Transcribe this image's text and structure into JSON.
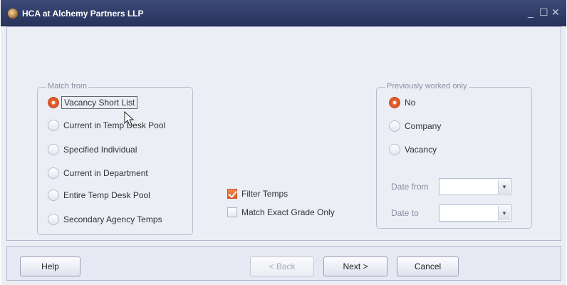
{
  "window": {
    "title": "HCA at Alchemy Partners LLP",
    "controls": {
      "minimize": "_",
      "maximize": "☐",
      "close": "✕"
    }
  },
  "match_from": {
    "legend": "Match from",
    "selected": "Vacancy Short List",
    "options": [
      {
        "label": "Vacancy Short List",
        "checked": true
      },
      {
        "label": "Current in Temp Desk Pool",
        "checked": false
      },
      {
        "label": "Specified Individual",
        "checked": false
      },
      {
        "label": "Current in Department",
        "checked": false
      },
      {
        "label": "Entire Temp Desk Pool",
        "checked": false
      },
      {
        "label": "Secondary Agency Temps",
        "checked": false
      }
    ]
  },
  "filters": {
    "filter_temps": {
      "label": "Filter Temps",
      "checked": true
    },
    "match_exact_grade": {
      "label": "Match Exact Grade Only",
      "checked": false
    }
  },
  "previously_worked": {
    "legend": "Previously worked only",
    "selected": "No",
    "options": [
      {
        "label": "No",
        "checked": true
      },
      {
        "label": "Company",
        "checked": false
      },
      {
        "label": "Vacancy",
        "checked": false
      }
    ],
    "date_from": {
      "label": "Date from",
      "value": ""
    },
    "date_to": {
      "label": "Date to",
      "value": ""
    }
  },
  "buttons": {
    "help": "Help",
    "back": "< Back",
    "next": "Next >",
    "cancel": "Cancel"
  },
  "icons": {
    "app": "app-logo-icon",
    "dropdown": "chevron-down-icon",
    "cursor": "mouse-cursor-icon"
  },
  "colors": {
    "titlebar": "#2f3a66",
    "accent": "#e8622e",
    "panel": "#eceef6"
  }
}
